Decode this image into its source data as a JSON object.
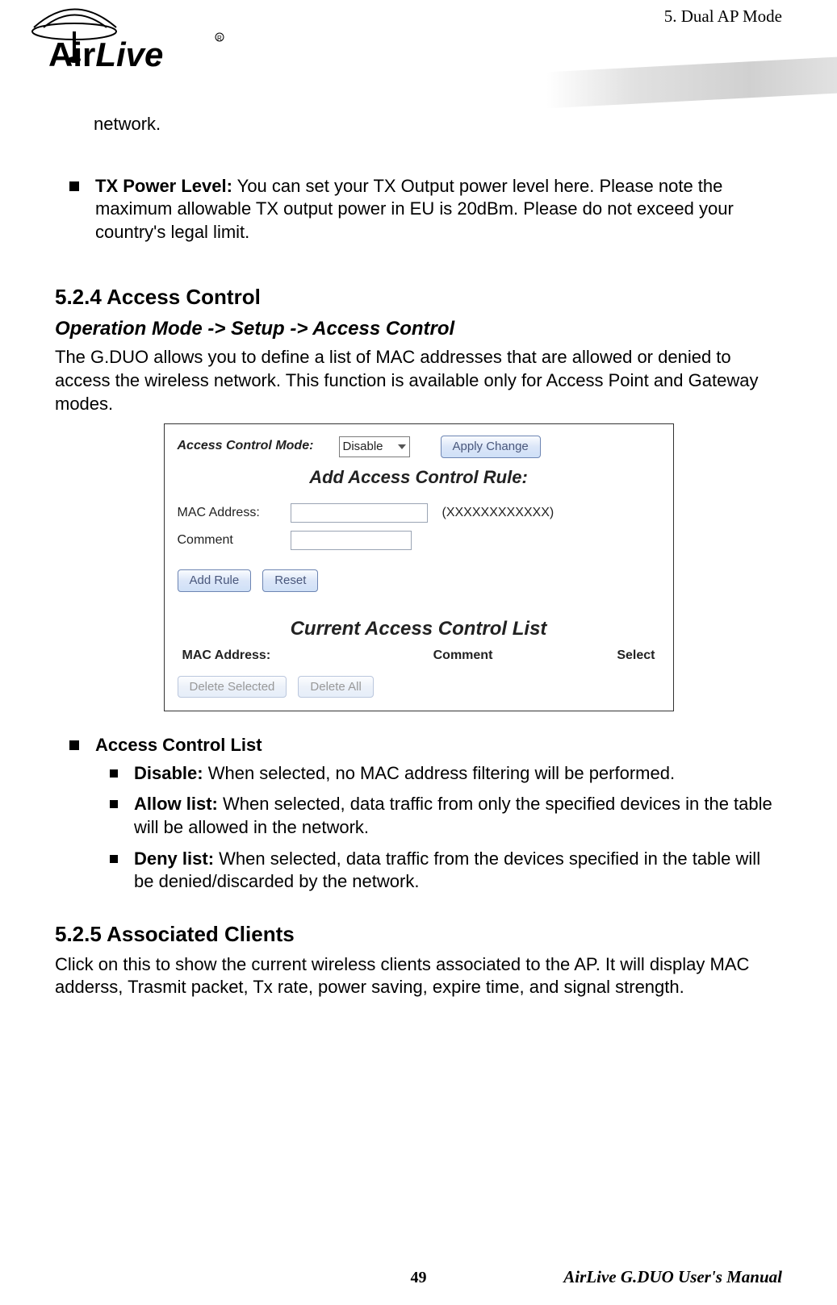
{
  "header": {
    "chapter": "5.  Dual AP Mode",
    "brand_primary": "Air",
    "brand_secondary": "Live"
  },
  "body": {
    "network_fragment": "network.",
    "tx_power": {
      "label": "TX Power Level:",
      "text": "   You can set your TX Output power level here.   Please note the maximum allowable TX output power in EU is 20dBm.   Please do not exceed your country's legal limit."
    },
    "s524": {
      "heading": "5.2.4 Access Control",
      "path": "Operation Mode -> Setup -> Access Control",
      "intro": "The G.DUO allows you to define a list of MAC addresses that are allowed or denied to access the wireless network.   This function is available only for Access Point and Gateway modes."
    },
    "ui": {
      "mode_label": "Access Control Mode:",
      "mode_value": "Disable",
      "apply": "Apply Change",
      "add_title": "Add Access Control Rule:",
      "mac_label": "MAC Address:",
      "mac_hint": "(XXXXXXXXXXXX)",
      "comment_label": "Comment",
      "add_rule": "Add Rule",
      "reset": "Reset",
      "current_title": "Current Access Control List",
      "thead": {
        "c1": "MAC Address:",
        "c2": "Comment",
        "c3": "Select"
      },
      "del_selected": "Delete Selected",
      "del_all": "Delete All"
    },
    "acl": {
      "heading": "Access Control List",
      "items": [
        {
          "label": "Disable:",
          "text": " When selected, no MAC address filtering will be performed."
        },
        {
          "label": "Allow list:",
          "text": " When selected, data traffic from only the specified devices in the table will be allowed in the network."
        },
        {
          "label": "Deny list:",
          "text": " When selected, data traffic from the devices specified in the table will be denied/discarded by the network."
        }
      ]
    },
    "s525": {
      "heading": "5.2.5 Associated Clients",
      "text": "Click on this to show the current wireless clients associated to the AP.   It will display MAC adderss, Trasmit packet, Tx rate, power saving, expire time, and signal strength."
    }
  },
  "footer": {
    "page_number": "49",
    "manual": "AirLive G.DUO User's Manual"
  }
}
